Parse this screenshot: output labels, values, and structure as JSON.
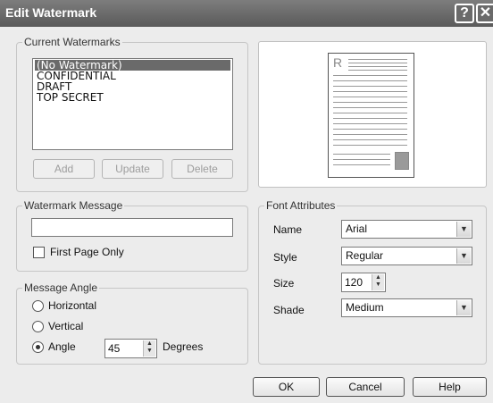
{
  "window": {
    "title": "Edit Watermark",
    "help_label": "?",
    "close_label": "✕"
  },
  "current_watermarks": {
    "group_label": "Current Watermarks",
    "items": [
      "(No Watermark)",
      "CONFIDENTIAL",
      "DRAFT",
      "TOP SECRET"
    ],
    "selected_index": 0,
    "add_label": "Add",
    "update_label": "Update",
    "delete_label": "Delete"
  },
  "preview": {
    "page_letter": "R"
  },
  "watermark_message": {
    "group_label": "Watermark Message",
    "value": "",
    "first_page_only_label": "First Page Only",
    "first_page_only_checked": false
  },
  "message_angle": {
    "group_label": "Message Angle",
    "horizontal_label": "Horizontal",
    "vertical_label": "Vertical",
    "angle_label": "Angle",
    "selected": "Angle",
    "angle_value": "45",
    "degrees_label": "Degrees"
  },
  "font_attributes": {
    "group_label": "Font Attributes",
    "name_label": "Name",
    "name_value": "Arial",
    "style_label": "Style",
    "style_value": "Regular",
    "size_label": "Size",
    "size_value": "120",
    "shade_label": "Shade",
    "shade_value": "Medium"
  },
  "footer": {
    "ok_label": "OK",
    "cancel_label": "Cancel",
    "help_label": "Help"
  },
  "colors": {
    "titlebar": "#6a6a6a",
    "selection": "#6a6a6a",
    "dialog_bg": "#ececec"
  },
  "icons": {
    "help": "question-icon",
    "close": "close-icon",
    "spin": "spin-arrows-icon",
    "dropdown": "chevron-down-icon"
  }
}
